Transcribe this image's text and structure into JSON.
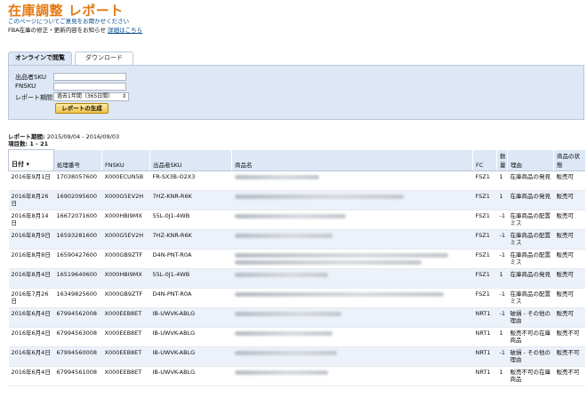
{
  "header": {
    "title": "在庫調整 レポート",
    "feedback_link": "このページについてご意見をお聞かせください",
    "notice_text": "FBA在庫の修正・更新内容をお知らせ",
    "notice_link": "詳細はこちら"
  },
  "tabs": [
    {
      "label": "オンラインで閲覧",
      "active": true
    },
    {
      "label": "ダウンロード",
      "active": false
    }
  ],
  "form": {
    "sku_label": "出品者SKU",
    "sku_value": "",
    "fnsku_label": "FNSKU",
    "fnsku_value": "",
    "period_label": "レポート期間",
    "period_selected": "過去1年間（365日間）",
    "generate_button": "レポートの生成"
  },
  "summary": {
    "period_label": "レポート期間:",
    "period_value": "2015/09/04 - 2016/09/03",
    "count_label": "項目数: 1 - 21"
  },
  "table": {
    "columns": [
      "日付",
      "処理番号",
      "FNSKU",
      "出品者SKU",
      "商品名",
      "FC",
      "数量",
      "理由",
      "商品の状態"
    ],
    "rows": [
      {
        "date": "2016年9月1日",
        "txn": "17038057600",
        "fnsku": "X000ECUN5B",
        "sku": "FR-SX3B-O2X3",
        "fc": "FSZ1",
        "qty": "1",
        "reason": "在庫商品の発見",
        "condition": "販売可"
      },
      {
        "date": "2016年8月26日",
        "txn": "16902095600",
        "fnsku": "X000G5EV2H",
        "sku": "7HZ-KNR-R6K",
        "fc": "FSZ1",
        "qty": "1",
        "reason": "在庫商品の発見",
        "condition": "販売可"
      },
      {
        "date": "2016年8月14日",
        "txn": "16672071600",
        "fnsku": "X000HBI9MX",
        "sku": "55L-0J1-4WB",
        "fc": "FSZ1",
        "qty": "-1",
        "reason": "在庫商品の配置ミス",
        "condition": "販売可"
      },
      {
        "date": "2016年8月9日",
        "txn": "16593281600",
        "fnsku": "X000G5EV2H",
        "sku": "7HZ-KNR-R6K",
        "fc": "FSZ1",
        "qty": "-1",
        "reason": "在庫商品の配置ミス",
        "condition": "販売可"
      },
      {
        "date": "2016年8月8日",
        "txn": "16590427600",
        "fnsku": "X000GB9ZTF",
        "sku": "D4N-PNT-R0A",
        "fc": "FSZ1",
        "qty": "-1",
        "reason": "在庫商品の配置ミス",
        "condition": "販売可"
      },
      {
        "date": "2016年8月4日",
        "txn": "16519640600",
        "fnsku": "X000HBI9MX",
        "sku": "55L-0J1-4WB",
        "fc": "FSZ1",
        "qty": "1",
        "reason": "在庫商品の発見",
        "condition": "販売可"
      },
      {
        "date": "2016年7月26日",
        "txn": "16349825600",
        "fnsku": "X000GB9ZTF",
        "sku": "D4N-PNT-R0A",
        "fc": "FSZ1",
        "qty": "-1",
        "reason": "在庫商品の配置ミス",
        "condition": "販売可"
      },
      {
        "date": "2016年6月4日",
        "txn": "67994562008",
        "fnsku": "X000EEB8ET",
        "sku": "IB-UWVK-ABLG",
        "fc": "NRT1",
        "qty": "-1",
        "reason": "破損 - その他の理由",
        "condition": "販売可"
      },
      {
        "date": "2016年6月4日",
        "txn": "67994563008",
        "fnsku": "X000EEB8ET",
        "sku": "IB-UWVK-ABLG",
        "fc": "NRT1",
        "qty": "1",
        "reason": "販売不可の在庫商品",
        "condition": "販売不可"
      },
      {
        "date": "2016年6月4日",
        "txn": "67994560008",
        "fnsku": "X000EEB8ET",
        "sku": "IB-UWVK-ABLG",
        "fc": "NRT1",
        "qty": "-1",
        "reason": "破損 - その他の理由",
        "condition": "販売不可"
      },
      {
        "date": "2016年6月4日",
        "txn": "67994561008",
        "fnsku": "X000EEB8ET",
        "sku": "IB-UWVK-ABLG",
        "fc": "NRT1",
        "qty": "1",
        "reason": "販売不可の在庫商品",
        "condition": "販売不可"
      }
    ]
  }
}
